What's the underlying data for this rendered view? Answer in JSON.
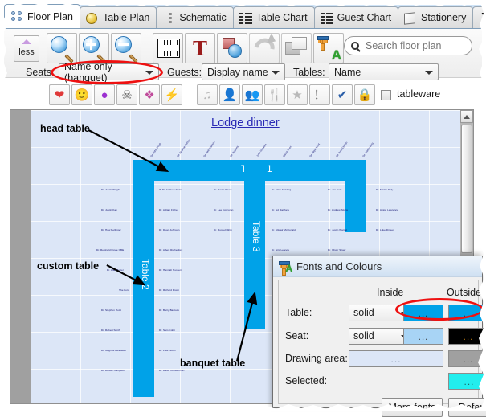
{
  "tabs": [
    {
      "label": "Floor Plan",
      "icon": "grid-dots-icon",
      "active": true
    },
    {
      "label": "Table Plan",
      "icon": "yellow-circle-icon",
      "active": false
    },
    {
      "label": "Schematic",
      "icon": "schematic-icon",
      "active": false
    },
    {
      "label": "Table Chart",
      "icon": "rows-icon",
      "active": false
    },
    {
      "label": "Guest Chart",
      "icon": "rows-icon",
      "active": false
    },
    {
      "label": "Stationery",
      "icon": "page-icon",
      "active": false
    },
    {
      "label": "Σ",
      "icon": "sigma-icon",
      "active": false
    }
  ],
  "tab_nav": {
    "prev": "◀",
    "next": "▶"
  },
  "toolbar": {
    "less_label": "less",
    "buttons": [
      {
        "name": "zoom-fit-icon",
        "title": "Zoom"
      },
      {
        "name": "zoom-in-icon",
        "title": "Zoom in"
      },
      {
        "name": "zoom-out-icon",
        "title": "Zoom out"
      },
      {
        "name": "ruler-icon",
        "title": "Ruler"
      },
      {
        "name": "text-icon",
        "title": "Text"
      },
      {
        "name": "shapes-icon",
        "title": "Shapes"
      },
      {
        "name": "redo-icon",
        "title": "Redo"
      },
      {
        "name": "layers-icon",
        "title": "Layers"
      },
      {
        "name": "fonts-and-colours-icon",
        "title": "Fonts and Colours"
      }
    ]
  },
  "search": {
    "placeholder": "Search floor plan",
    "value": "",
    "icon": "search-icon"
  },
  "options": {
    "seats_label": "Seats:",
    "seats_value": "Name only (banquet)",
    "guests_label": "Guests:",
    "guests_value": "Display name",
    "tables_label": "Tables:",
    "tables_value": "Name"
  },
  "symbols": {
    "enabled": [
      "❤",
      "🙂",
      "●",
      "☠",
      "❖",
      "⚡"
    ],
    "disabled": [
      "♫",
      "👤",
      "👥",
      "🍴",
      "★",
      "！",
      "✔",
      "🔒"
    ],
    "tableware_label": "tableware",
    "tableware_checked": false
  },
  "plan": {
    "title": "Lodge dinner",
    "tables": [
      {
        "name": "Table 1",
        "orientation": "horizontal"
      },
      {
        "name": "Table 2",
        "orientation": "vertical"
      },
      {
        "name": "Table 3",
        "orientation": "vertical"
      }
    ],
    "annotations": [
      {
        "text": "head table"
      },
      {
        "text": "custom table"
      },
      {
        "text": "banquet table"
      }
    ],
    "seat_names_top": [
      "Dr. John Ough",
      "Dr. Andrew Burton",
      "Dr. Neil Franklin",
      "Dr. Ruperts",
      "John Hopkins",
      "David Hunt",
      "Dr. Nigel Hunt",
      "Dr. Paul Chilton",
      "Dr. Martin Daly"
    ],
    "seat_names": [
      "Dr. Justin Wright",
      "W Dr. Andrew Atkins",
      "Dr. Justin Shaw",
      "Dr. Mark Fielding",
      "Dr. Jim Cain",
      "Dr. Martin Daly",
      "Dr. Justin Kay",
      "Dr. Adrian Fisher",
      "Dr. Lee Corcoran",
      "Dr. Ed Matthew",
      "Dr. Andrew Atkins",
      "Dr. Anton Lawrence",
      "Dr. Huw Bellinger",
      "Dr. Dean Johnson",
      "Dr. Russell Shin",
      "Dr. Alistair McDonald",
      "Dr. Justin Waring",
      "Dr. Luke Dineen",
      "Dr. Reginald Doyle OBE",
      "Dr. Albert Rutherford",
      "Dr. Eric Lefevre",
      "Dr. Oliver Shaw",
      "Dr. Alan Porter",
      "Dr. Hannah Hussein",
      "Dr. George Kayson",
      "Dr. Stephen Oakley",
      "The Lord",
      "Dr. Richard Dixon",
      "Dr. Huw Clef",
      "Dr. Joseph Silk",
      "Dr. Stephen Hoist",
      "Dr. Barry Bastock",
      "Dr. Robert Smith",
      "Dr. Sam Cobh",
      "Dr. Magnus Lancaster",
      "Dr. Paul Novel",
      "Dr. David Thompson",
      "Dr. David Chesterman"
    ]
  },
  "dialog": {
    "title": "Fonts and Colours",
    "icon": "fonts-and-colours-icon",
    "col_inside": "Inside",
    "col_outside": "Outside",
    "rows": [
      {
        "label": "Table:",
        "style": "solid",
        "inside": "#00a2e8",
        "outside": "#00a2e8",
        "dots": "..."
      },
      {
        "label": "Seat:",
        "style": "solid",
        "inside": "#a8d4f5",
        "outside": "#000000",
        "dots": "..."
      },
      {
        "label": "Drawing area:",
        "style": null,
        "inside": "#dce6f7",
        "outside": "#a0a0a0",
        "dots": "..."
      },
      {
        "label": "Selected:",
        "style": null,
        "inside": null,
        "outside": "#22eeee",
        "dots": "..."
      }
    ],
    "buttons": [
      {
        "label": "More fonts"
      },
      {
        "label": "Defaul"
      }
    ]
  },
  "highlights": [
    {
      "name": "seats-combo-highlight"
    },
    {
      "name": "table-colour-swatches-highlight"
    }
  ],
  "colors": {
    "table_blue": "#00a2e8",
    "drawing_inside": "#dce6f7",
    "drawing_outside": "#a0a0a0",
    "selected": "#22eeee",
    "seat_inside": "#a8d4f5",
    "seat_outside": "#000000",
    "annotation_red": "#ee1111",
    "title_blue": "#2a2ab5"
  }
}
